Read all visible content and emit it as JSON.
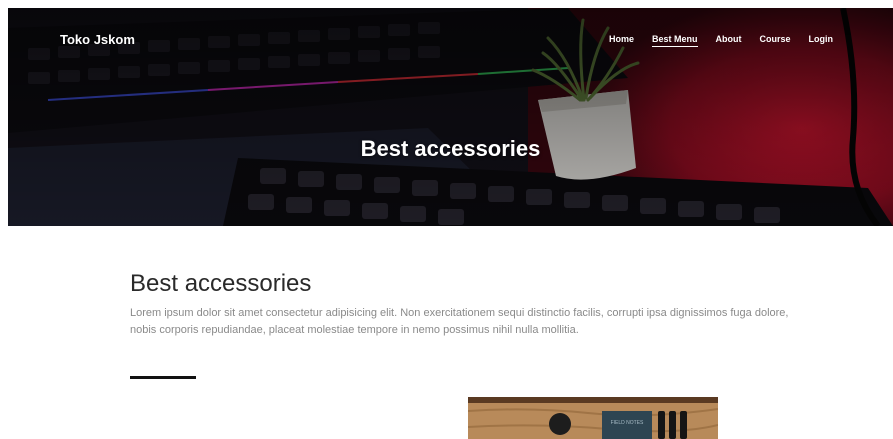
{
  "header": {
    "brand": "Toko Jskom",
    "nav": [
      {
        "label": "Home",
        "active": false
      },
      {
        "label": "Best Menu",
        "active": true
      },
      {
        "label": "About",
        "active": false
      },
      {
        "label": "Course",
        "active": false
      },
      {
        "label": "Login",
        "active": false
      }
    ]
  },
  "hero": {
    "title": "Best accessories",
    "image": "keyboard-and-plant-photo"
  },
  "content": {
    "title": "Best accessories",
    "text": "Lorem ipsum dolor sit amet consectetur adipisicing elit. Non exercitationem sequi distinctio facilis, corrupti ipsa dignissimos fuga dolore, nobis corporis repudiandae, placeat molestiae tempore in nemo possimus nihil nulla mollitia.",
    "product_image": "accessories-on-wood-photo",
    "product_image_text": "FIELD NOTES"
  },
  "colors": {
    "hero_accent_red": "#b3122a",
    "divider": "#111111",
    "text_muted": "#8a8a8a"
  }
}
